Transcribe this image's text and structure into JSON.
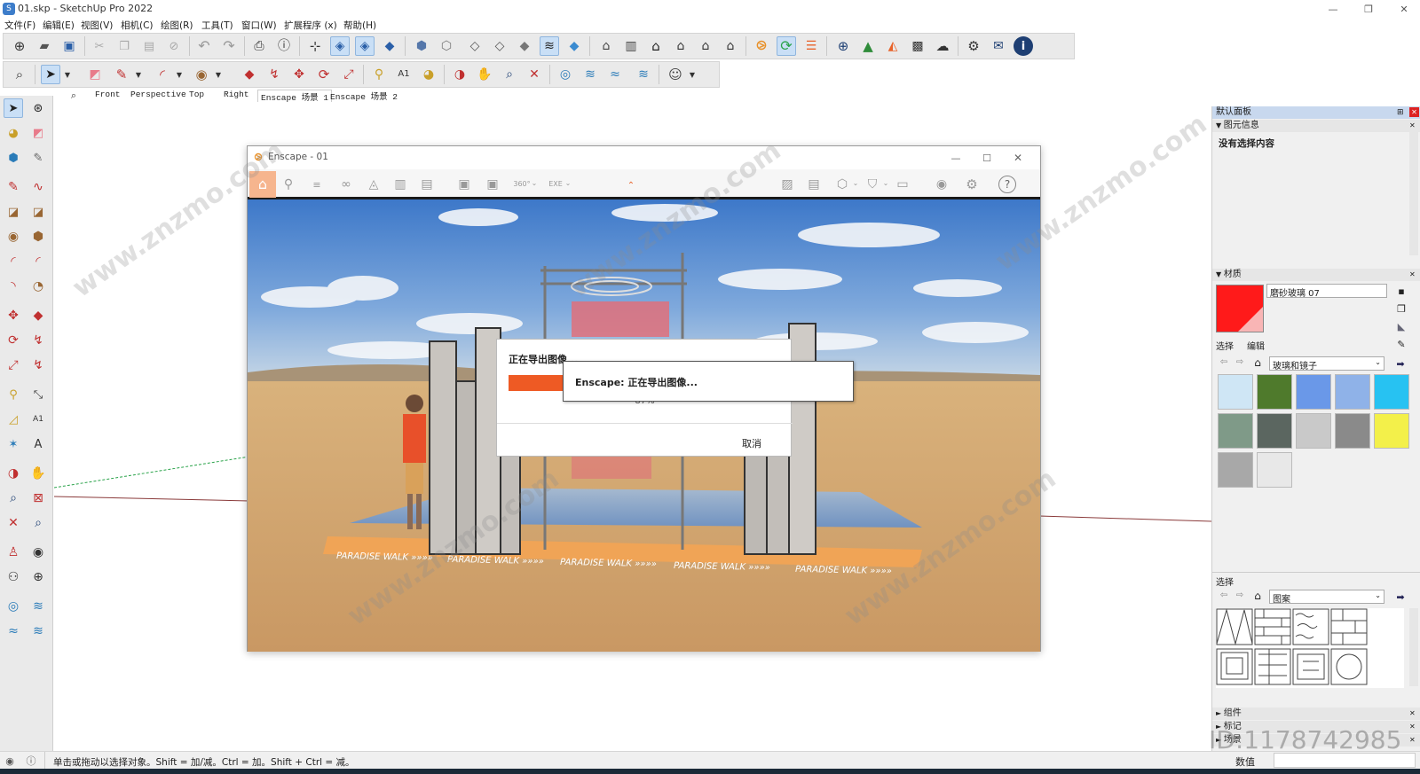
{
  "app": {
    "title": "01.skp - SketchUp Pro 2022",
    "window_buttons": [
      "—",
      "❐",
      "✕"
    ]
  },
  "menu": [
    "文件(F)",
    "编辑(E)",
    "视图(V)",
    "相机(C)",
    "绘图(R)",
    "工具(T)",
    "窗口(W)",
    "扩展程序 (x)",
    "帮助(H)"
  ],
  "scene_tabs": [
    "Front",
    "Perspective",
    "Top",
    "Right",
    "Enscape 场景 1",
    "Enscape 场景 2"
  ],
  "enscape": {
    "title": "Enscape - 01",
    "banner_text": "PARADISE WALK »»»»",
    "export_dialog": {
      "title": "正在导出图像...",
      "progress_percent": 87,
      "progress_label": "87%",
      "cancel_label": "取消",
      "popup_text": "Enscape: 正在导出图像..."
    }
  },
  "tray": {
    "title": "默认面板",
    "entity_info": {
      "header": "图元信息",
      "text": "没有选择内容"
    },
    "materials": {
      "header": "材质",
      "name": "磨砂玻璃 07",
      "tab_select": "选择",
      "tab_edit": "编辑",
      "collection": "玻璃和镜子",
      "swatch_colors": [
        "#cfe6f5",
        "#4f7a2c",
        "#6a98e8",
        "#8fb2e8",
        "#27c2f2",
        "#7f9a88",
        "#5b6660",
        "#c9c9c9",
        "#8a8a8a",
        "#f3f04a",
        "#a8a8a8",
        "#e8e8e8"
      ]
    },
    "select2": {
      "header": "选择",
      "collection": "图案"
    },
    "components": "组件",
    "tags": "标记",
    "scenes": "场景"
  },
  "status": {
    "hint": "单击或拖动以选择对象。Shift = 加/减。Ctrl = 加。Shift + Ctrl = 减。",
    "value_label": "数值",
    "watermark_id": "ID:1178742985"
  },
  "watermark_text": "www.znzmo.com",
  "colors": {
    "accent": "#e8632a",
    "sketchup_blue": "#3d7dca",
    "selected_mat": "#ff1a1a"
  }
}
